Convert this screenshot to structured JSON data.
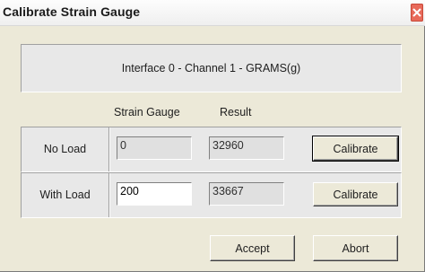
{
  "window": {
    "title": "Calibrate Strain Gauge"
  },
  "header": {
    "interface_text": "Interface 0 - Channel 1 - GRAMS(g)"
  },
  "columns": {
    "strain_gauge": "Strain Gauge",
    "result": "Result"
  },
  "rows": [
    {
      "label": "No Load",
      "strain_gauge_value": "0",
      "result_value": "32960",
      "button_label": "Calibrate"
    },
    {
      "label": "With Load",
      "strain_gauge_value": "200",
      "result_value": "33667",
      "button_label": "Calibrate"
    }
  ],
  "footer": {
    "accept_label": "Accept",
    "abort_label": "Abort"
  },
  "icons": {
    "close": "close-icon"
  },
  "colors": {
    "close_button": "#e86a5a",
    "background": "#ece9d8"
  }
}
